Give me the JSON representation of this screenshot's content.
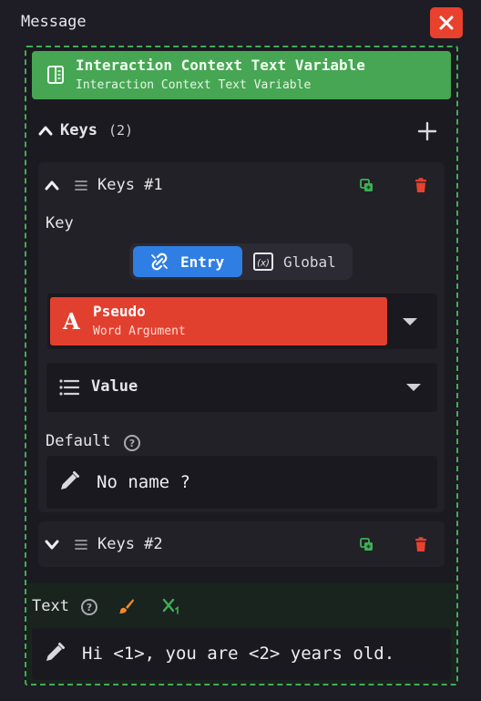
{
  "header": {
    "label": "Message",
    "close_icon": "close-icon"
  },
  "variable": {
    "title": "Interaction Context Text Variable",
    "subtitle": "Interaction Context Text Variable",
    "icon": "book-icon",
    "color": "#46a653"
  },
  "keys": {
    "label": "Keys",
    "count": "(2)",
    "items": [
      {
        "title": "Keys #1",
        "expanded": true,
        "key_label": "Key",
        "toggle": {
          "entry_label": "Entry",
          "global_label": "Global",
          "selected": "Entry"
        },
        "pseudo": {
          "title": "Pseudo",
          "subtitle": "Word Argument",
          "color": "#e2402f"
        },
        "value_label": "Value",
        "default_label": "Default",
        "default_value": "No name ?"
      },
      {
        "title": "Keys #2",
        "expanded": false
      }
    ]
  },
  "text": {
    "label": "Text",
    "value": "Hi <1>, you are <2> years old."
  },
  "colors": {
    "accent_green": "#46a653",
    "danger_red": "#e8412e",
    "toggle_blue": "#2f7ee3"
  }
}
